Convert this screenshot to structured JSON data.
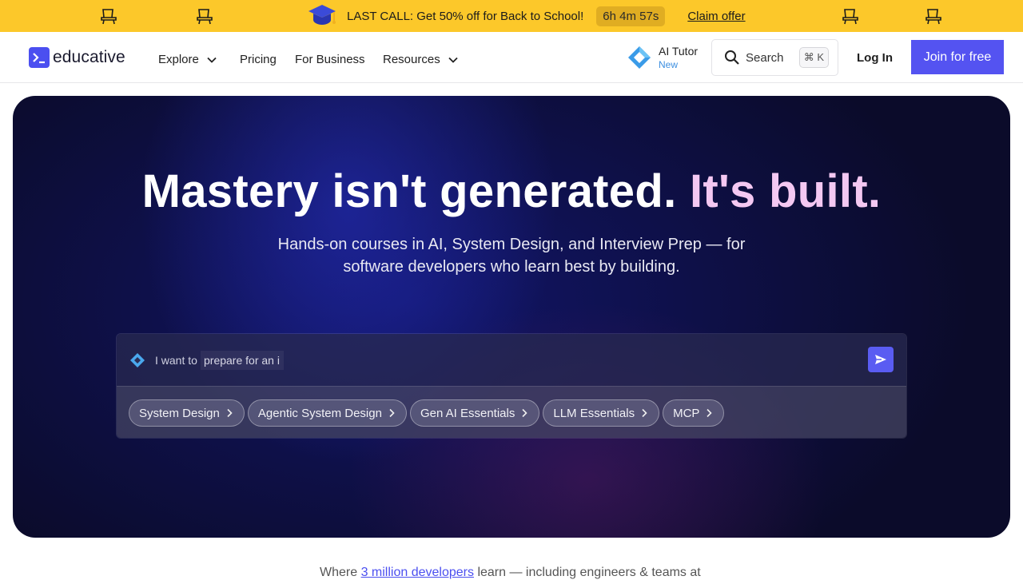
{
  "promo": {
    "text": "LAST CALL: Get 50% off for Back to School!",
    "timer": "6h 4m 57s",
    "claim": "Claim offer",
    "icon": "graduation-cap-icon",
    "decor_icon": "chair-icon"
  },
  "nav": {
    "logo_text": "educative",
    "items": [
      {
        "label": "Explore",
        "has_dropdown": true
      },
      {
        "label": "Pricing",
        "has_dropdown": false
      },
      {
        "label": "For Business",
        "has_dropdown": false
      },
      {
        "label": "Resources",
        "has_dropdown": true
      }
    ],
    "ai_tutor": {
      "label": "AI Tutor",
      "badge": "New"
    },
    "search": {
      "label": "Search",
      "shortcut": "⌘ K"
    },
    "login": "Log In",
    "join": "Join for free"
  },
  "hero": {
    "title_main": "Mastery isn't generated.",
    "title_accent": "It's built.",
    "subtitle": "Hands-on courses in AI, System Design, and Interview Prep — for software developers who learn best by building.",
    "prompt": {
      "prefix": "I want to",
      "value": "prepare for an i"
    },
    "chips": [
      "System Design",
      "Agentic System Design",
      "Gen AI Essentials",
      "LLM Essentials",
      "MCP"
    ]
  },
  "below": {
    "before": "Where",
    "highlight": "3 million developers",
    "after": "learn — including engineers & teams at"
  },
  "colors": {
    "banner": "#fcc82a",
    "primary": "#5453f1",
    "accent_title": "#f4c8f2",
    "hero_bg": "#0b0b2a"
  }
}
